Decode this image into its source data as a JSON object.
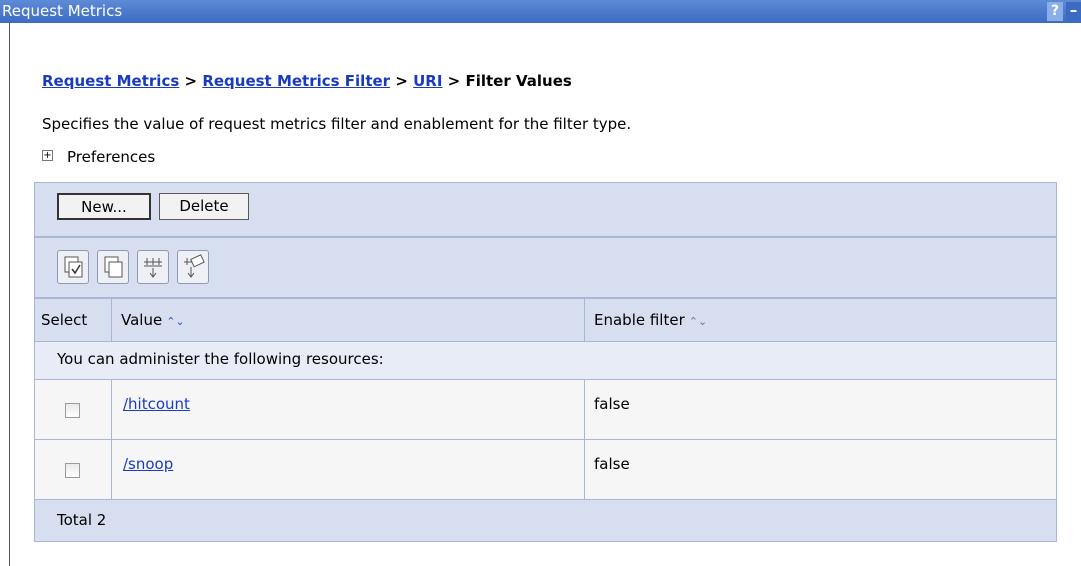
{
  "window": {
    "title": "Request Metrics",
    "help_label": "?",
    "minimize_label": "–"
  },
  "breadcrumb": {
    "items": [
      "Request Metrics",
      "Request Metrics Filter",
      "URI"
    ],
    "separator": ">",
    "current": "Filter Values"
  },
  "description": "Specifies the value of request metrics filter and enablement for the filter type.",
  "preferences": {
    "expand_label": "+",
    "label": "Preferences"
  },
  "buttons": {
    "new": "New...",
    "delete": "Delete"
  },
  "toolbar_icons": [
    "select-all-icon",
    "deselect-all-icon",
    "show-filter-icon",
    "clear-filter-icon"
  ],
  "table": {
    "headers": {
      "select": "Select",
      "value": "Value",
      "enable": "Enable filter"
    },
    "sort_glyph": "⌃⌄",
    "resources_caption": "You can administer the following resources:",
    "rows": [
      {
        "value": "/hitcount",
        "enable": "false"
      },
      {
        "value": "/snoop",
        "enable": "false"
      }
    ],
    "total": "Total 2"
  },
  "colors": {
    "titlebar": "#3c6bc2",
    "panel": "#d7def0",
    "link": "#1a3bbf"
  }
}
